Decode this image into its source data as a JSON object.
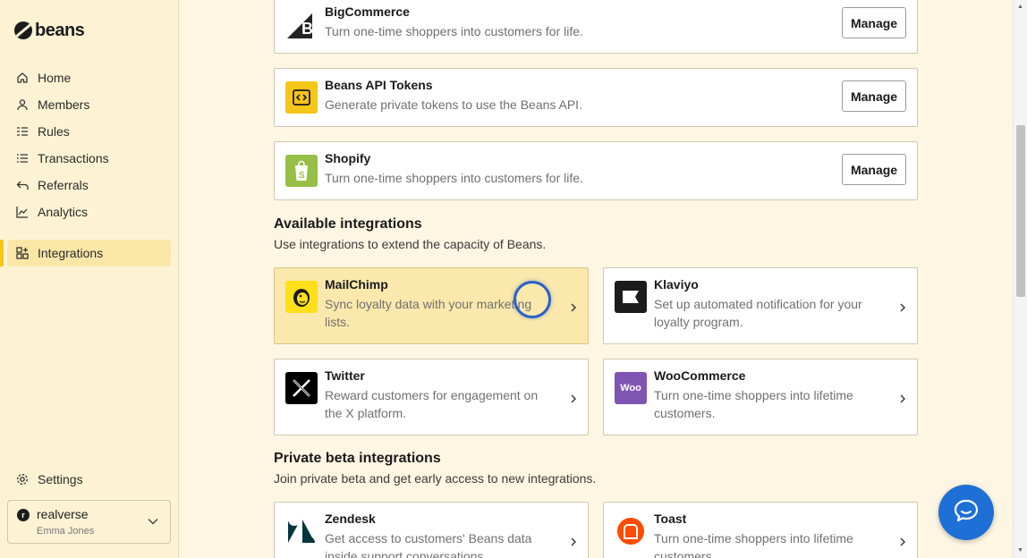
{
  "brand": {
    "name": "beans"
  },
  "sidebar": {
    "items": [
      {
        "label": "Home",
        "icon": "home-icon"
      },
      {
        "label": "Members",
        "icon": "user-icon"
      },
      {
        "label": "Rules",
        "icon": "rules-icon"
      },
      {
        "label": "Transactions",
        "icon": "list-icon"
      },
      {
        "label": "Referrals",
        "icon": "referral-icon"
      },
      {
        "label": "Analytics",
        "icon": "chart-icon"
      },
      {
        "label": "Integrations",
        "icon": "integrations-icon",
        "active": true
      }
    ],
    "settings_label": "Settings",
    "account": {
      "initial": "r",
      "name": "realverse",
      "user": "Emma Jones"
    }
  },
  "installed": [
    {
      "name": "BigCommerce",
      "desc": "Turn one-time shoppers into customers for life.",
      "button": "Manage",
      "icon": "bigcommerce-icon"
    },
    {
      "name": "Beans API Tokens",
      "desc": "Generate private tokens to use the Beans API.",
      "button": "Manage",
      "icon": "api-code-icon"
    },
    {
      "name": "Shopify",
      "desc": "Turn one-time shoppers into customers for life.",
      "button": "Manage",
      "icon": "shopify-icon"
    }
  ],
  "available": {
    "title": "Available integrations",
    "subtitle": "Use integrations to extend the capacity of Beans.",
    "items": [
      {
        "name": "MailChimp",
        "desc": "Sync loyalty data with your marketing lists.",
        "icon": "mailchimp-icon"
      },
      {
        "name": "Klaviyo",
        "desc": "Set up automated notification for your loyalty program.",
        "icon": "klaviyo-icon"
      },
      {
        "name": "Twitter",
        "desc": "Reward customers for engagement on the X platform.",
        "icon": "x-icon"
      },
      {
        "name": "WooCommerce",
        "desc": "Turn one-time shoppers into lifetime customers.",
        "icon": "woocommerce-icon",
        "logo_text": "Woo"
      }
    ]
  },
  "private_beta": {
    "title": "Private beta integrations",
    "subtitle": "Join private beta and get early access to new integrations.",
    "items": [
      {
        "name": "Zendesk",
        "desc": "Get access to customers' Beans data inside support conversations.",
        "icon": "zendesk-icon"
      },
      {
        "name": "Toast",
        "desc": "Turn one-time shoppers into lifetime customers.",
        "icon": "toast-icon"
      }
    ]
  },
  "colors": {
    "accent": "#f5c518",
    "chat": "#1e6fd6",
    "sidebar_bg": "#fdf3d4"
  }
}
